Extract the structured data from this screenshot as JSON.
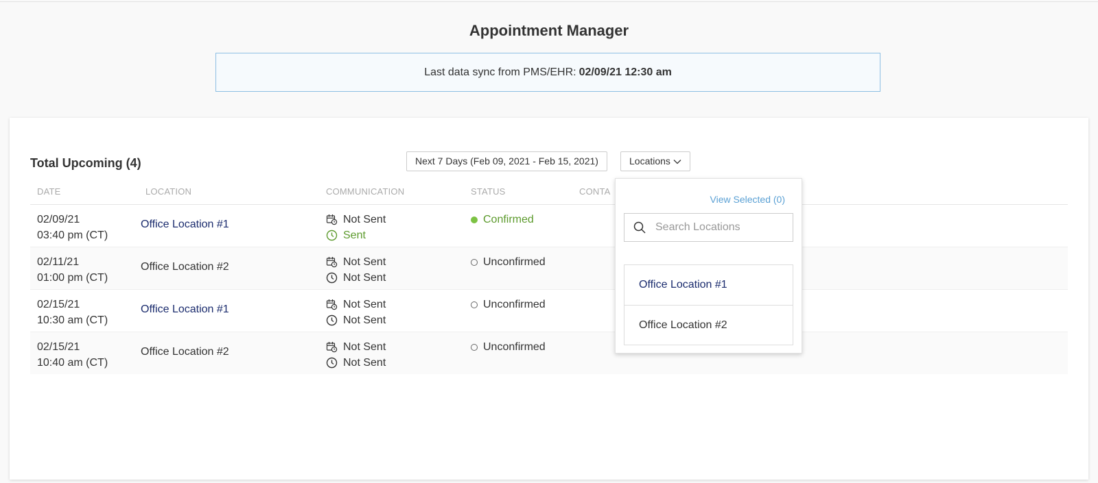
{
  "header": {
    "title": "Appointment Manager",
    "sync_label": "Last data sync from PMS/EHR:",
    "sync_value": "02/09/21 12:30 am"
  },
  "toolbar": {
    "total_label": "Total Upcoming (4)",
    "range_label": "Next 7 Days (Feb 09, 2021 - Feb 15, 2021)",
    "locations_label": "Locations"
  },
  "table": {
    "columns": [
      "DATE",
      "LOCATION",
      "COMMUNICATION",
      "STATUS",
      "CONTA"
    ],
    "rows": [
      {
        "date": "02/09/21",
        "time": "03:40 pm (CT)",
        "location": "Office Location #1",
        "comm1": "Not Sent",
        "comm2": "Sent",
        "status": "Confirmed"
      },
      {
        "date": "02/11/21",
        "time": "01:00 pm (CT)",
        "location": "Office Location #2",
        "comm1": "Not Sent",
        "comm2": "Not Sent",
        "status": "Unconfirmed"
      },
      {
        "date": "02/15/21",
        "time": "10:30 am (CT)",
        "location": "Office Location #1",
        "comm1": "Not Sent",
        "comm2": "Not Sent",
        "status": "Unconfirmed"
      },
      {
        "date": "02/15/21",
        "time": "10:40 am (CT)",
        "location": "Office Location #2",
        "comm1": "Not Sent",
        "comm2": "Not Sent",
        "status": "Unconfirmed"
      }
    ]
  },
  "dropdown": {
    "view_selected": "View Selected (0)",
    "search_placeholder": "Search Locations",
    "options": [
      "Office Location #1",
      "Office Location #2"
    ]
  },
  "colors": {
    "link": "#1a2b6d",
    "success": "#5c9a2c",
    "accent": "#5aa0d4",
    "banner_border": "#8dbfe3"
  }
}
